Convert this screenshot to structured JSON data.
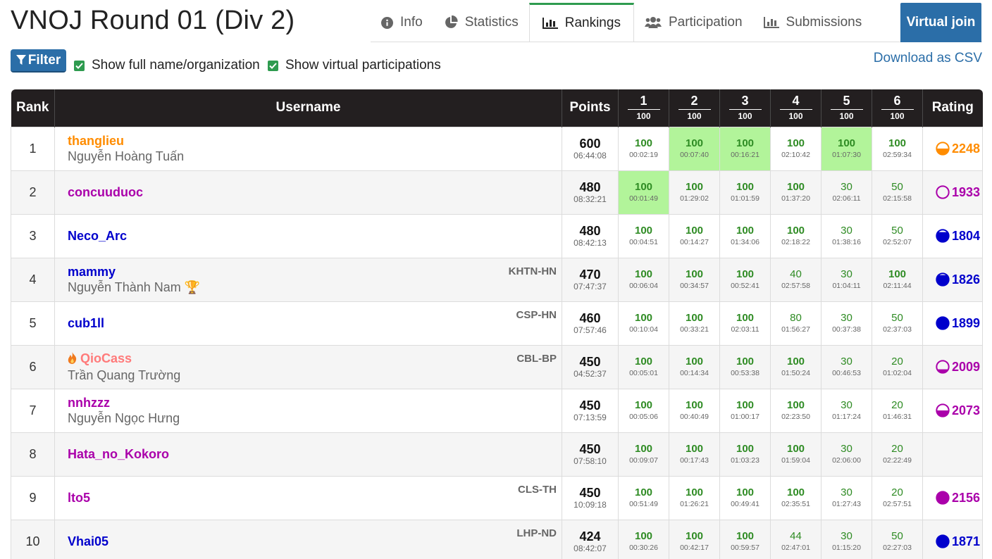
{
  "page": {
    "title": "VNOJ Round 01 (Div 2)"
  },
  "tabs": [
    {
      "label": "Info",
      "icon": "info-circle-icon",
      "active": false
    },
    {
      "label": "Statistics",
      "icon": "pie-chart-icon",
      "active": false
    },
    {
      "label": "Rankings",
      "icon": "bar-chart-icon",
      "active": true
    },
    {
      "label": "Participation",
      "icon": "users-icon",
      "active": false
    },
    {
      "label": "Submissions",
      "icon": "bar-chart-icon",
      "active": false
    }
  ],
  "virtual_join_label": "Virtual join",
  "toolbar": {
    "filter_label": "Filter",
    "show_full_name_label": "Show full name/organization",
    "show_virtual_label": "Show virtual participations",
    "download_csv_label": "Download as CSV"
  },
  "colors": {
    "accent_blue": "#2b6ea8",
    "header_bg": "#231f20",
    "full_score_green": "#2e8b23",
    "first_solve_bg": "#b2f49a",
    "rating_orange": "#ff8c00",
    "rating_purple": "#a0a",
    "rating_blue": "#00c",
    "rating_pink": "#ff7a7a"
  },
  "table": {
    "headers": {
      "rank": "Rank",
      "username": "Username",
      "points": "Points",
      "rating": "Rating"
    },
    "problems": [
      {
        "number": "1",
        "points": "100"
      },
      {
        "number": "2",
        "points": "100"
      },
      {
        "number": "3",
        "points": "100"
      },
      {
        "number": "4",
        "points": "100"
      },
      {
        "number": "5",
        "points": "100"
      },
      {
        "number": "6",
        "points": "100"
      }
    ],
    "rows": [
      {
        "rank": "1",
        "username": "thanglieu",
        "user_color": "#ff8c00",
        "full_name": "Nguyễn Hoàng Tuấn",
        "org": "",
        "points": "600",
        "time": "06:44:08",
        "cells": [
          {
            "score": "100",
            "time": "00:02:19",
            "full": true,
            "first": false
          },
          {
            "score": "100",
            "time": "00:07:40",
            "full": true,
            "first": true
          },
          {
            "score": "100",
            "time": "00:16:21",
            "full": true,
            "first": true
          },
          {
            "score": "100",
            "time": "02:10:42",
            "full": true,
            "first": false
          },
          {
            "score": "100",
            "time": "01:07:30",
            "full": true,
            "first": true
          },
          {
            "score": "100",
            "time": "02:59:34",
            "full": true,
            "first": false
          }
        ],
        "rating": "2248",
        "rating_color": "#ff8c00",
        "rating_fill": 0.5
      },
      {
        "rank": "2",
        "username": "concuuduoc",
        "user_color": "#a0a",
        "full_name": "",
        "org": "",
        "points": "480",
        "time": "08:32:21",
        "cells": [
          {
            "score": "100",
            "time": "00:01:49",
            "full": true,
            "first": true
          },
          {
            "score": "100",
            "time": "01:29:02",
            "full": true,
            "first": false
          },
          {
            "score": "100",
            "time": "01:01:59",
            "full": true,
            "first": false
          },
          {
            "score": "100",
            "time": "01:37:20",
            "full": true,
            "first": false
          },
          {
            "score": "30",
            "time": "02:06:11",
            "full": false,
            "first": false
          },
          {
            "score": "50",
            "time": "02:15:58",
            "full": false,
            "first": false
          }
        ],
        "rating": "1933",
        "rating_color": "#a0a",
        "rating_fill": 0.0
      },
      {
        "rank": "3",
        "username": "Neco_Arc",
        "user_color": "#00c",
        "full_name": "",
        "org": "",
        "points": "480",
        "time": "08:42:13",
        "cells": [
          {
            "score": "100",
            "time": "00:04:51",
            "full": true,
            "first": false
          },
          {
            "score": "100",
            "time": "00:14:27",
            "full": true,
            "first": false
          },
          {
            "score": "100",
            "time": "01:34:06",
            "full": true,
            "first": false
          },
          {
            "score": "100",
            "time": "02:18:22",
            "full": true,
            "first": false
          },
          {
            "score": "30",
            "time": "01:38:16",
            "full": false,
            "first": false
          },
          {
            "score": "50",
            "time": "02:52:07",
            "full": false,
            "first": false
          }
        ],
        "rating": "1804",
        "rating_color": "#00c",
        "rating_fill": 0.8
      },
      {
        "rank": "4",
        "username": "mammy",
        "user_color": "#00c",
        "full_name": "Nguyễn Thành Nam 🏆",
        "org": "KHTN-HN",
        "points": "470",
        "time": "07:47:37",
        "cells": [
          {
            "score": "100",
            "time": "00:06:04",
            "full": true,
            "first": false
          },
          {
            "score": "100",
            "time": "00:34:57",
            "full": true,
            "first": false
          },
          {
            "score": "100",
            "time": "00:52:41",
            "full": true,
            "first": false
          },
          {
            "score": "40",
            "time": "02:57:58",
            "full": false,
            "first": false
          },
          {
            "score": "30",
            "time": "01:04:11",
            "full": false,
            "first": false
          },
          {
            "score": "100",
            "time": "02:11:44",
            "full": true,
            "first": false
          }
        ],
        "rating": "1826",
        "rating_color": "#00c",
        "rating_fill": 0.85
      },
      {
        "rank": "5",
        "username": "cub1ll",
        "user_color": "#00c",
        "full_name": "",
        "org": "CSP-HN",
        "points": "460",
        "time": "07:57:46",
        "cells": [
          {
            "score": "100",
            "time": "00:10:04",
            "full": true,
            "first": false
          },
          {
            "score": "100",
            "time": "00:33:21",
            "full": true,
            "first": false
          },
          {
            "score": "100",
            "time": "02:03:11",
            "full": true,
            "first": false
          },
          {
            "score": "80",
            "time": "01:56:27",
            "full": false,
            "first": false
          },
          {
            "score": "30",
            "time": "00:37:38",
            "full": false,
            "first": false
          },
          {
            "score": "50",
            "time": "02:37:03",
            "full": false,
            "first": false
          }
        ],
        "rating": "1899",
        "rating_color": "#00c",
        "rating_fill": 1.0
      },
      {
        "rank": "6",
        "username": "QioCass",
        "user_color": "#ff7a7a",
        "user_icon": "fire-icon",
        "full_name": "Trần Quang Trường",
        "org": "CBL-BP",
        "points": "450",
        "time": "04:52:37",
        "cells": [
          {
            "score": "100",
            "time": "00:05:01",
            "full": true,
            "first": false
          },
          {
            "score": "100",
            "time": "00:14:34",
            "full": true,
            "first": false
          },
          {
            "score": "100",
            "time": "00:53:38",
            "full": true,
            "first": false
          },
          {
            "score": "100",
            "time": "01:50:24",
            "full": true,
            "first": false
          },
          {
            "score": "30",
            "time": "00:46:53",
            "full": false,
            "first": false
          },
          {
            "score": "20",
            "time": "01:02:04",
            "full": false,
            "first": false
          }
        ],
        "rating": "2009",
        "rating_color": "#a0a",
        "rating_fill": 0.3
      },
      {
        "rank": "7",
        "username": "nnhzzz",
        "user_color": "#a0a",
        "full_name": "Nguyễn Ngọc Hưng",
        "org": "",
        "points": "450",
        "time": "07:13:59",
        "cells": [
          {
            "score": "100",
            "time": "00:05:06",
            "full": true,
            "first": false
          },
          {
            "score": "100",
            "time": "00:40:49",
            "full": true,
            "first": false
          },
          {
            "score": "100",
            "time": "01:00:17",
            "full": true,
            "first": false
          },
          {
            "score": "100",
            "time": "02:23:50",
            "full": true,
            "first": false
          },
          {
            "score": "30",
            "time": "01:17:24",
            "full": false,
            "first": false
          },
          {
            "score": "20",
            "time": "01:46:31",
            "full": false,
            "first": false
          }
        ],
        "rating": "2073",
        "rating_color": "#a0a",
        "rating_fill": 0.5
      },
      {
        "rank": "8",
        "username": "Hata_no_Kokoro",
        "user_color": "#a0a",
        "full_name": "",
        "org": "",
        "points": "450",
        "time": "07:58:10",
        "cells": [
          {
            "score": "100",
            "time": "00:09:07",
            "full": true,
            "first": false
          },
          {
            "score": "100",
            "time": "00:17:43",
            "full": true,
            "first": false
          },
          {
            "score": "100",
            "time": "01:03:23",
            "full": true,
            "first": false
          },
          {
            "score": "100",
            "time": "01:59:04",
            "full": true,
            "first": false
          },
          {
            "score": "30",
            "time": "02:06:00",
            "full": false,
            "first": false
          },
          {
            "score": "20",
            "time": "02:22:49",
            "full": false,
            "first": false
          }
        ],
        "rating": "",
        "rating_color": "#a0a",
        "rating_fill": 0
      },
      {
        "rank": "9",
        "username": "lto5",
        "user_color": "#a0a",
        "full_name": "",
        "org": "CLS-TH",
        "points": "450",
        "time": "10:09:18",
        "cells": [
          {
            "score": "100",
            "time": "00:51:49",
            "full": true,
            "first": false
          },
          {
            "score": "100",
            "time": "01:26:21",
            "full": true,
            "first": false
          },
          {
            "score": "100",
            "time": "00:49:41",
            "full": true,
            "first": false
          },
          {
            "score": "100",
            "time": "02:35:51",
            "full": true,
            "first": false
          },
          {
            "score": "30",
            "time": "01:27:43",
            "full": false,
            "first": false
          },
          {
            "score": "20",
            "time": "02:57:51",
            "full": false,
            "first": false
          }
        ],
        "rating": "2156",
        "rating_color": "#a0a",
        "rating_fill": 1.0
      },
      {
        "rank": "10",
        "username": "Vhai05",
        "user_color": "#00c",
        "full_name": "",
        "org": "LHP-ND",
        "points": "424",
        "time": "08:42:07",
        "cells": [
          {
            "score": "100",
            "time": "00:30:26",
            "full": true,
            "first": false
          },
          {
            "score": "100",
            "time": "00:42:17",
            "full": true,
            "first": false
          },
          {
            "score": "100",
            "time": "00:59:57",
            "full": true,
            "first": false
          },
          {
            "score": "44",
            "time": "02:47:01",
            "full": false,
            "first": false
          },
          {
            "score": "30",
            "time": "01:15:20",
            "full": false,
            "first": false
          },
          {
            "score": "50",
            "time": "02:27:03",
            "full": false,
            "first": false
          }
        ],
        "rating": "1871",
        "rating_color": "#00c",
        "rating_fill": 1.0
      }
    ]
  }
}
